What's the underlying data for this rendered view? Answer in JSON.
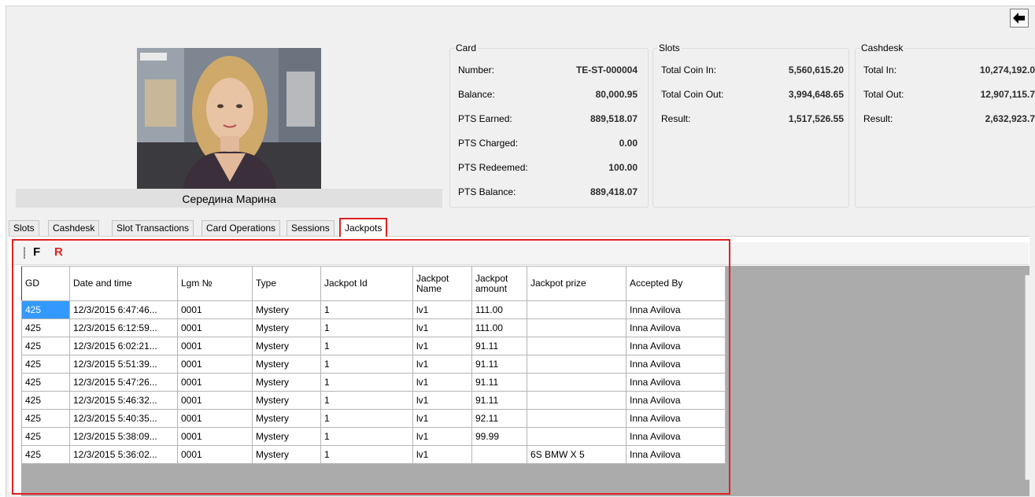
{
  "header": {
    "back_icon": "back-arrow-icon",
    "player_name": "Середина Марина"
  },
  "card": {
    "legend": "Card",
    "rows": [
      {
        "label": "Number:",
        "value": "TE-ST-000004"
      },
      {
        "label": "Balance:",
        "value": "80,000.95"
      },
      {
        "label": "PTS Earned:",
        "value": "889,518.07"
      },
      {
        "label": "PTS Charged:",
        "value": "0.00"
      },
      {
        "label": "PTS Redeemed:",
        "value": "100.00"
      },
      {
        "label": "PTS Balance:",
        "value": "889,418.07"
      }
    ]
  },
  "slots": {
    "legend": "Slots",
    "rows": [
      {
        "label": "Total Coin In:",
        "value": "5,560,615.20"
      },
      {
        "label": "Total Coin Out:",
        "value": "3,994,648.65"
      },
      {
        "label": "Result:",
        "value": "1,517,526.55"
      }
    ]
  },
  "cashdesk": {
    "legend": "Cashdesk",
    "rows": [
      {
        "label": "Total In:",
        "value": "10,274,192.0"
      },
      {
        "label": "Total Out:",
        "value": "12,907,115.7"
      },
      {
        "label": "Result:",
        "value": "2,632,923.7"
      }
    ]
  },
  "tabs": [
    "Slots",
    "Cashdesk",
    "Slot Transactions",
    "Card Operations",
    "Sessions",
    "Jackpots"
  ],
  "active_tab": "Jackpots",
  "toolbar": {
    "filter_label": "F",
    "refresh_label": "R",
    "refresh_color": "#e02020"
  },
  "colors": {
    "highlight": "#e02020",
    "selection": "#3399ff"
  },
  "grid": {
    "columns": [
      "GD",
      "Date and time",
      "Lgm №",
      "Type",
      "Jackpot Id",
      "Jackpot Name",
      "Jackpot amount",
      "Jackpot prize",
      "Accepted By"
    ],
    "rows": [
      [
        "425",
        "12/3/2015 6:47:46...",
        "0001",
        "Mystery",
        "1",
        "lv1",
        "111.00",
        "",
        "Inna Avilova"
      ],
      [
        "425",
        "12/3/2015 6:12:59...",
        "0001",
        "Mystery",
        "1",
        "lv1",
        "111.00",
        "",
        "Inna Avilova"
      ],
      [
        "425",
        "12/3/2015 6:02:21...",
        "0001",
        "Mystery",
        "1",
        "lv1",
        "91.11",
        "",
        "Inna Avilova"
      ],
      [
        "425",
        "12/3/2015 5:51:39...",
        "0001",
        "Mystery",
        "1",
        "lv1",
        "91.11",
        "",
        "Inna Avilova"
      ],
      [
        "425",
        "12/3/2015 5:47:26...",
        "0001",
        "Mystery",
        "1",
        "lv1",
        "91.11",
        "",
        "Inna Avilova"
      ],
      [
        "425",
        "12/3/2015 5:46:32...",
        "0001",
        "Mystery",
        "1",
        "lv1",
        "91.11",
        "",
        "Inna Avilova"
      ],
      [
        "425",
        "12/3/2015 5:40:35...",
        "0001",
        "Mystery",
        "1",
        "lv1",
        "92.11",
        "",
        "Inna Avilova"
      ],
      [
        "425",
        "12/3/2015 5:38:09...",
        "0001",
        "Mystery",
        "1",
        "lv1",
        "99.99",
        "",
        "Inna Avilova"
      ],
      [
        "425",
        "12/3/2015 5:36:02...",
        "0001",
        "Mystery",
        "1",
        "lv1",
        "",
        "6S BMW X 5",
        "Inna Avilova"
      ]
    ]
  }
}
